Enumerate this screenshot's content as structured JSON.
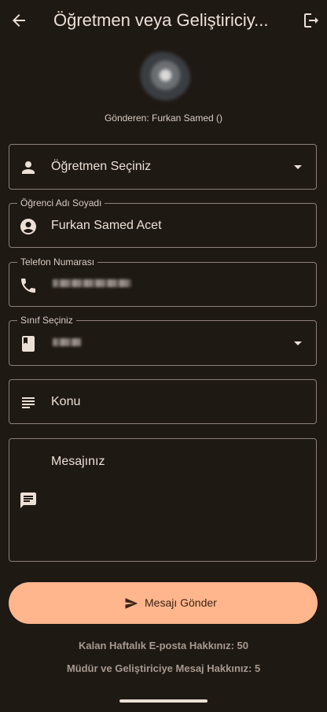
{
  "appbar": {
    "title": "Öğretmen veya Geliştiriciy..."
  },
  "sender": "Gönderen: Furkan Samed ()",
  "fields": {
    "teacher": {
      "value": "Öğretmen Seçiniz"
    },
    "student": {
      "label": "Öğrenci Adı Soyadı",
      "value": "Furkan Samed Acet"
    },
    "phone": {
      "label": "Telefon Numarası"
    },
    "class": {
      "label": "Sınıf Seçiniz"
    },
    "subject": {
      "placeholder": "Konu"
    },
    "message": {
      "placeholder": "Mesajınız"
    }
  },
  "send_button": {
    "label": "Mesajı Gönder"
  },
  "quota": {
    "weekly_email": "Kalan Haftalık E-posta Hakkınız: 50",
    "principal": "Müdür ve Geliştiriciye Mesaj Hakkınız: 5"
  },
  "colors": {
    "background": "#1f1914",
    "accent": "#ffb68c",
    "text": "#ece0d6",
    "outline": "#8c8078"
  }
}
